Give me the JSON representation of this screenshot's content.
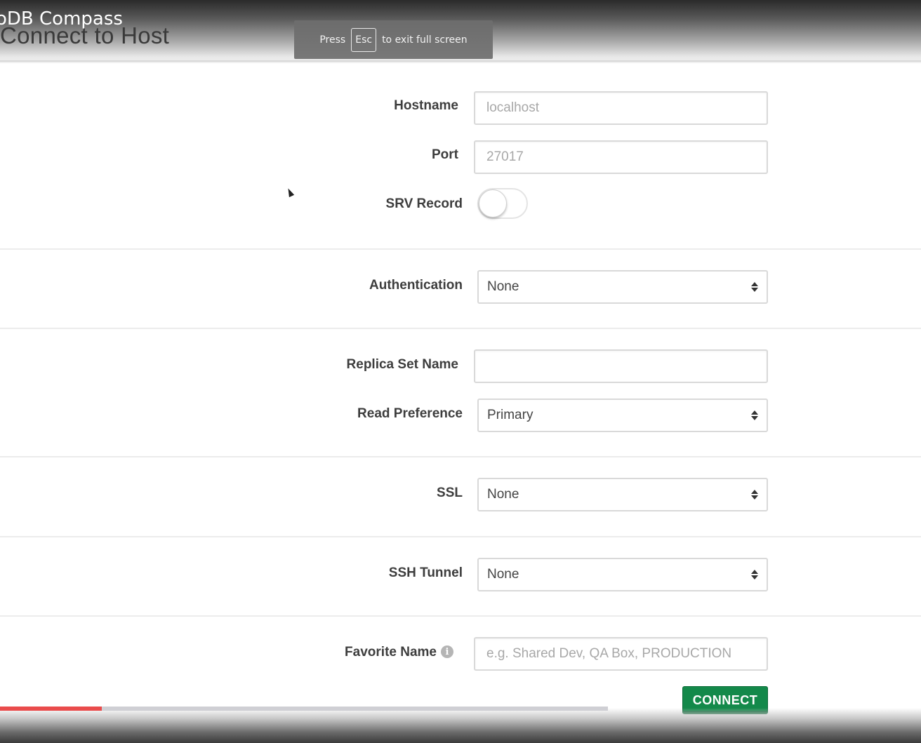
{
  "overlay": {
    "video_title": "oDB Compass",
    "esc_toast": {
      "prefix": "Press",
      "key": "Esc",
      "suffix": "to exit full screen"
    }
  },
  "page": {
    "heading": "Connect to Host"
  },
  "form": {
    "hostname": {
      "label": "Hostname",
      "placeholder": "localhost"
    },
    "port": {
      "label": "Port",
      "placeholder": "27017"
    },
    "srv_record": {
      "label": "SRV Record",
      "enabled": false
    },
    "authentication": {
      "label": "Authentication",
      "value": "None"
    },
    "replica_set_name": {
      "label": "Replica Set Name",
      "value": ""
    },
    "read_preference": {
      "label": "Read Preference",
      "value": "Primary"
    },
    "ssl": {
      "label": "SSL",
      "value": "None"
    },
    "ssh_tunnel": {
      "label": "SSH Tunnel",
      "value": "None"
    },
    "favorite_name": {
      "label": "Favorite Name",
      "placeholder": "e.g. Shared Dev, QA Box, PRODUCTION",
      "info_icon": "info-icon"
    },
    "connect_label": "CONNECT"
  },
  "player": {
    "progress_fraction": 0.168,
    "accent": "#e94b4b"
  },
  "colors": {
    "connect_button": "#13894a"
  }
}
